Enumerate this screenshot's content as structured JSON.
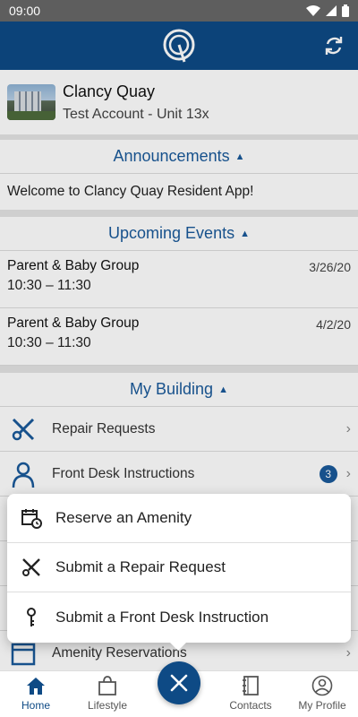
{
  "status_bar": {
    "time": "09:00"
  },
  "header": {
    "logo": "Q-logo-icon",
    "refresh_icon": "refresh-icon"
  },
  "building": {
    "name": "Clancy Quay",
    "unit": "Test Account - Unit 13x"
  },
  "announcements": {
    "title": "Announcements",
    "items": [
      "Welcome to Clancy Quay Resident App!"
    ]
  },
  "events": {
    "title": "Upcoming Events",
    "items": [
      {
        "title": "Parent & Baby Group",
        "time": "10:30 – 11:30",
        "date": "3/26/20"
      },
      {
        "title": "Parent & Baby Group",
        "time": "10:30 – 11:30",
        "date": "4/2/20"
      }
    ]
  },
  "my_building": {
    "title": "My Building",
    "items": [
      {
        "label": "Repair Requests",
        "icon": "tools-icon"
      },
      {
        "label": "Front Desk Instructions",
        "icon": "person-icon",
        "count": "3"
      },
      {
        "label": "Amenity Reservations",
        "icon": "amenity-icon"
      }
    ]
  },
  "popup_menu": {
    "items": [
      {
        "label": "Reserve an Amenity",
        "icon": "calendar-clock-icon"
      },
      {
        "label": "Submit a Repair Request",
        "icon": "tools-icon"
      },
      {
        "label": "Submit a Front Desk Instruction",
        "icon": "key-icon"
      }
    ]
  },
  "tabs": [
    {
      "label": "Home",
      "icon": "home-icon"
    },
    {
      "label": "Lifestyle",
      "icon": "bag-icon"
    },
    {
      "label": "",
      "icon": "close-icon"
    },
    {
      "label": "Contacts",
      "icon": "contacts-icon"
    },
    {
      "label": "My Profile",
      "icon": "profile-icon"
    }
  ],
  "colors": {
    "brand": "#0e4a85",
    "accent_text": "#1a5a9a"
  }
}
